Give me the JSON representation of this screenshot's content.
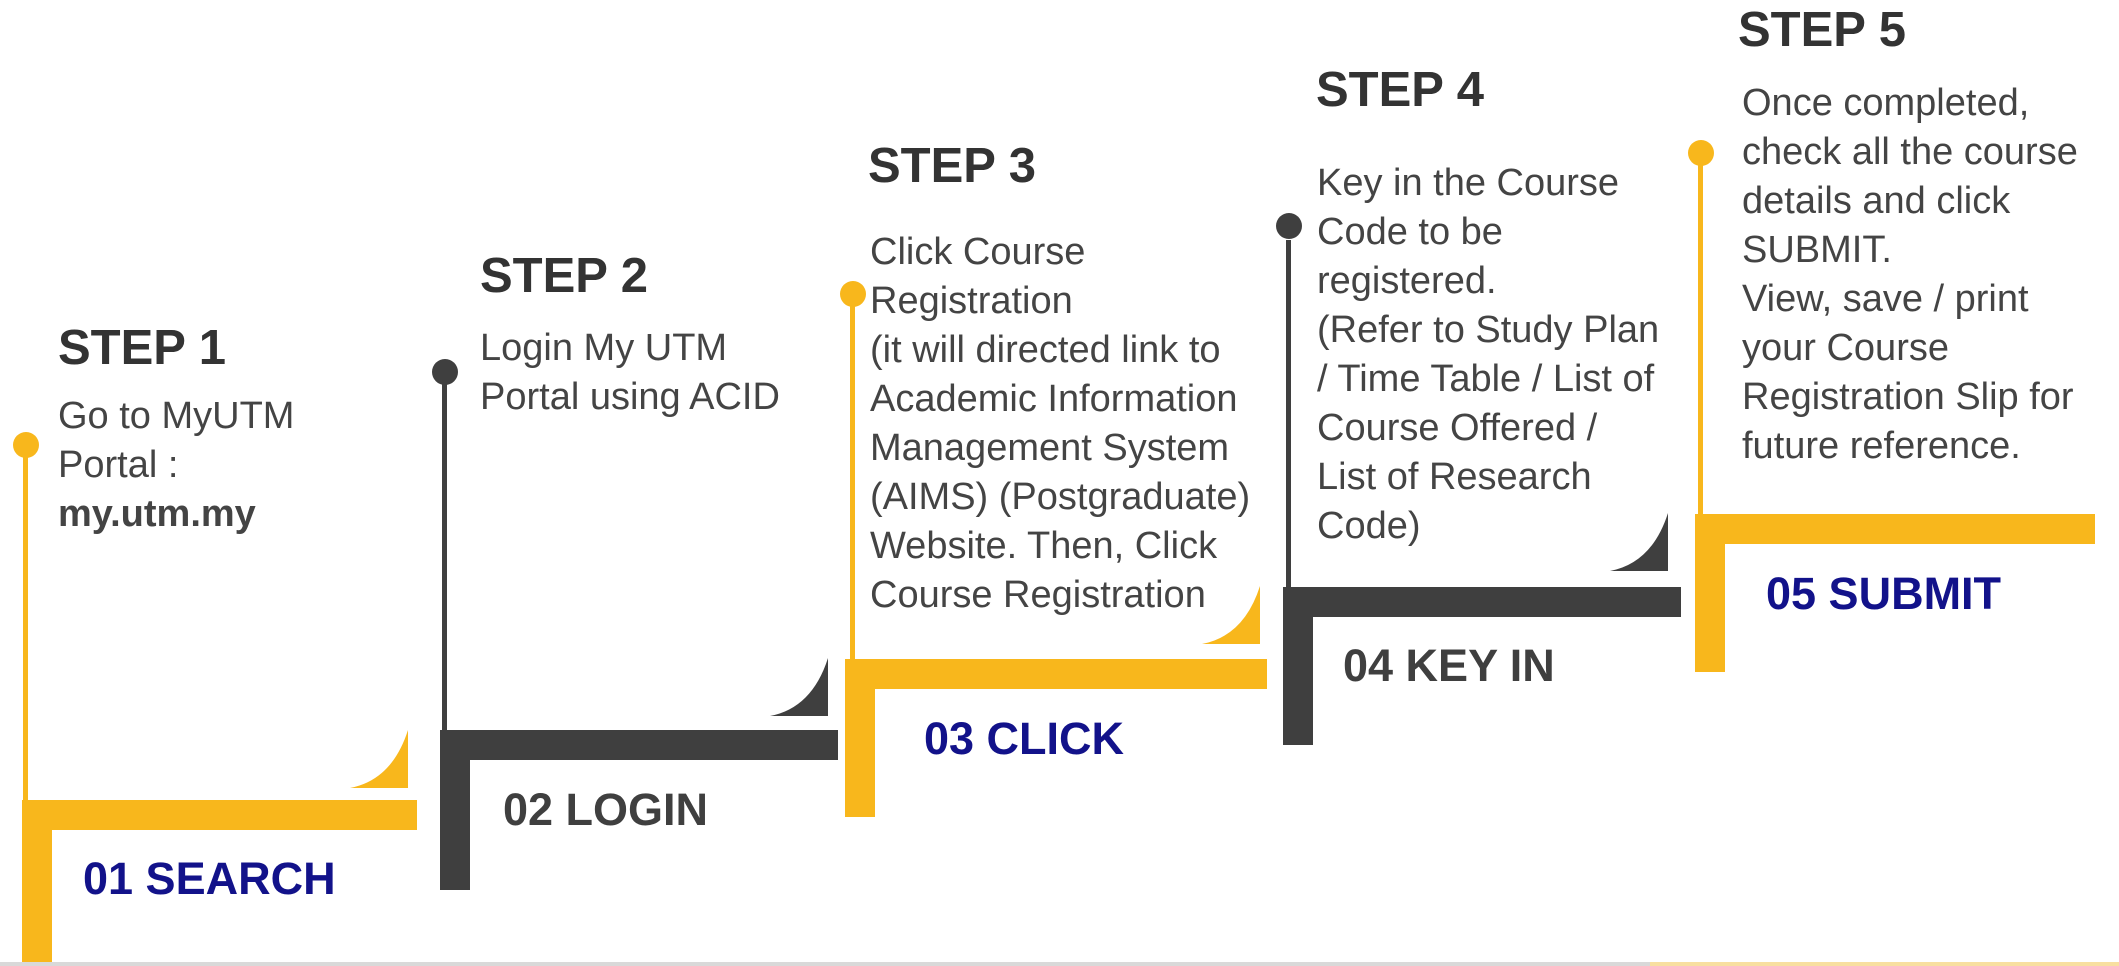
{
  "colors": {
    "accent_yellow": "#F8B71C",
    "dark_grey": "#3F3F3F",
    "label_blue": "#12128A",
    "title_grey": "#333333"
  },
  "steps": [
    {
      "title": "STEP 1",
      "desc_lines": [
        "Go to MyUTM",
        "Portal :"
      ],
      "desc_bold": "my.utm.my",
      "label": "01 SEARCH"
    },
    {
      "title": "STEP 2",
      "desc_lines": [
        "Login My UTM",
        "Portal using ACID"
      ],
      "label": "02 LOGIN"
    },
    {
      "title": "STEP 3",
      "desc_lines": [
        "Click Course",
        "Registration",
        "(it will directed link to",
        "Academic Information",
        "Management System",
        "(AIMS) (Postgraduate)",
        "Website. Then, Click",
        "Course Registration"
      ],
      "label": "03 CLICK"
    },
    {
      "title": "STEP 4",
      "desc_lines": [
        "Key in the Course",
        "Code to be",
        "registered.",
        "(Refer to Study Plan",
        "/ Time Table / List of",
        "Course Offered /",
        "List of Research",
        "Code)"
      ],
      "label": "04 KEY IN"
    },
    {
      "title": "STEP 5",
      "desc_lines": [
        "Once completed,",
        "check all the course",
        "details and click",
        "SUBMIT.",
        "View, save / print",
        "your Course",
        "Registration Slip for",
        "future reference."
      ],
      "label": "05 SUBMIT"
    }
  ]
}
